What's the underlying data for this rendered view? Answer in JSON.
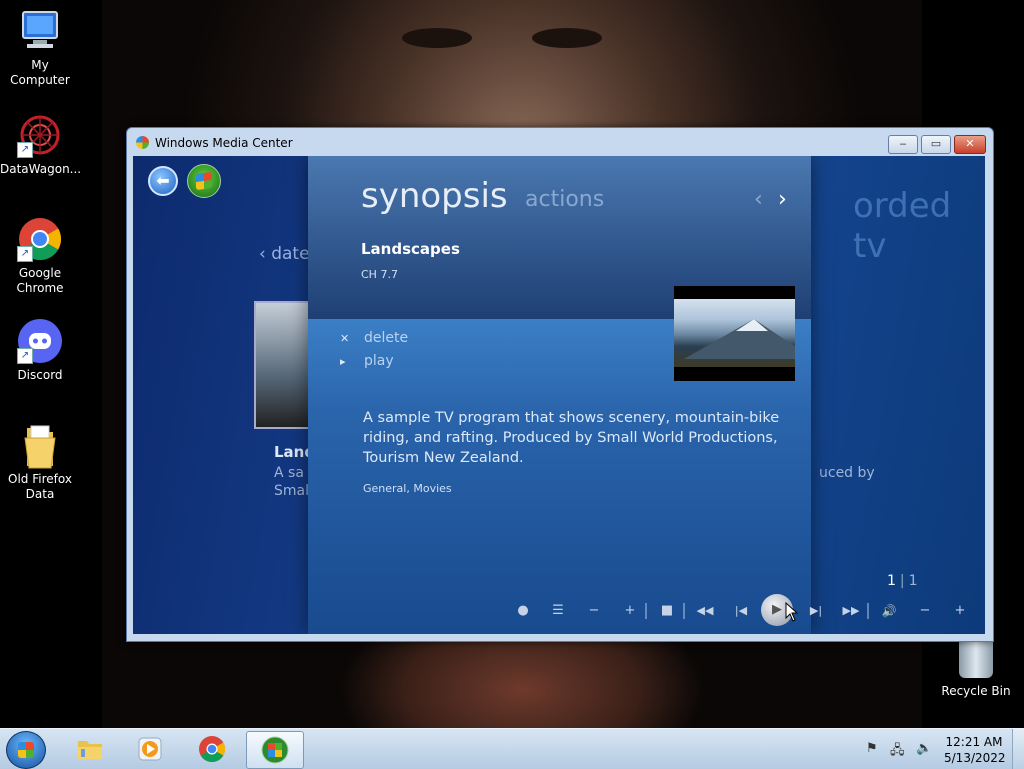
{
  "desktop": {
    "icons": [
      {
        "label": "My Computer",
        "icon": "computer-icon"
      },
      {
        "label": "DataWagon...",
        "icon": "datawagon-icon"
      },
      {
        "label": "Google Chrome",
        "icon": "chrome-icon"
      },
      {
        "label": "Discord",
        "icon": "discord-icon"
      },
      {
        "label": "Old Firefox Data",
        "icon": "folder-icon"
      }
    ],
    "recycle_bin": "Recycle Bin"
  },
  "window": {
    "title": "Windows Media Center",
    "controls": {
      "minimize": "‒",
      "maximize": "▭",
      "close": "✕"
    }
  },
  "media_center": {
    "background_title": "orded tv",
    "date_crumb": "date",
    "background_item": {
      "title": "Land",
      "description_line1": "A sa",
      "description_line2": "Small",
      "right_fragment": "uced by"
    },
    "synopsis": {
      "tab_active": "synopsis",
      "tab_inactive": "actions",
      "program_title": "Landscapes",
      "channel": "CH 7.7",
      "actions": [
        {
          "marker": "✕",
          "label": "delete"
        },
        {
          "marker": "▸",
          "label": "play"
        }
      ],
      "description": "A sample TV program that shows scenery, mountain-bike riding, and rafting. Produced by Small World Productions, Tourism New Zealand.",
      "genres": "General, Movies"
    },
    "page": {
      "current": "1",
      "total": "1"
    },
    "transport": [
      {
        "name": "record-button",
        "glyph": "●"
      },
      {
        "name": "guide-button",
        "glyph": "☰"
      },
      {
        "name": "channel-down-button",
        "glyph": "−"
      },
      {
        "name": "channel-up-button",
        "glyph": "+"
      },
      {
        "name": "stop-button",
        "glyph": "■"
      },
      {
        "name": "rewind-button",
        "glyph": "◀◀"
      },
      {
        "name": "skip-back-button",
        "glyph": "|◀"
      },
      {
        "name": "play-button",
        "glyph": "▶"
      },
      {
        "name": "skip-forward-button",
        "glyph": "▶|"
      },
      {
        "name": "fast-forward-button",
        "glyph": "▶▶"
      },
      {
        "name": "mute-button",
        "glyph": "🔊"
      },
      {
        "name": "volume-down-button",
        "glyph": "−"
      },
      {
        "name": "volume-up-button",
        "glyph": "+"
      }
    ]
  },
  "taskbar": {
    "clock_time": "12:21 AM",
    "clock_date": "5/13/2022"
  }
}
